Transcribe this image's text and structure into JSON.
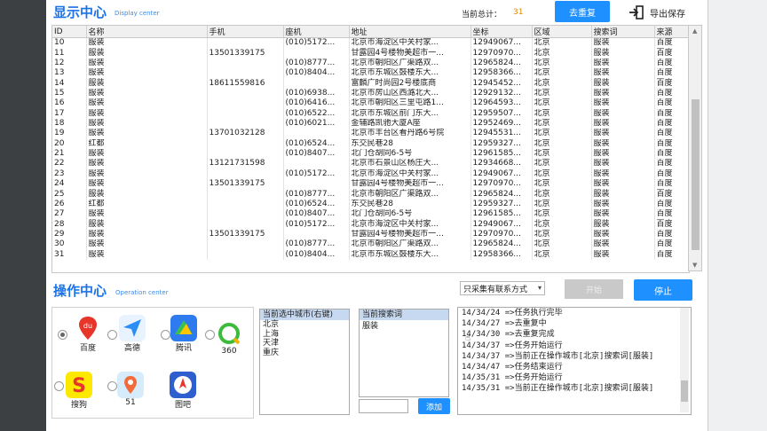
{
  "display": {
    "title": "显示中心",
    "subtitle": "Display center",
    "total_label": "当前总计：",
    "total_value": "31",
    "dedupe_label": "去重复",
    "export_label": "导出保存"
  },
  "table": {
    "columns": [
      "ID",
      "名称",
      "手机",
      "座机",
      "地址",
      "坐标",
      "区域",
      "搜索词",
      "来源"
    ],
    "rows": [
      [
        "10",
        "服装",
        "",
        "(010)5172...",
        "北京市海淀区中关村家...",
        "12949067...",
        "北京",
        "服装",
        "百度"
      ],
      [
        "11",
        "服装",
        "13501339175",
        "",
        "甘露园4号楼物美超市一...",
        "12970970...",
        "北京",
        "服装",
        "百度"
      ],
      [
        "12",
        "服装",
        "",
        "(010)8777...",
        "北京市朝阳区广渠路双...",
        "12965824...",
        "北京",
        "服装",
        "百度"
      ],
      [
        "13",
        "服装",
        "",
        "(010)8404...",
        "北京市东城区鼓楼东大...",
        "12958366...",
        "北京",
        "服装",
        "百度"
      ],
      [
        "14",
        "服装",
        "18611559816",
        "",
        "富麟广时尚园2号楼底商",
        "12945452...",
        "北京",
        "服装",
        "百度"
      ],
      [
        "15",
        "服装",
        "",
        "(010)6938...",
        "北京市房山区西潞北大...",
        "12929132...",
        "北京",
        "服装",
        "百度"
      ],
      [
        "16",
        "服装",
        "",
        "(010)6416...",
        "北京市朝阳区三里屯路1...",
        "12964593...",
        "北京",
        "服装",
        "百度"
      ],
      [
        "17",
        "服装",
        "",
        "(010)6522...",
        "北京市东城区前门东大...",
        "12959507...",
        "北京",
        "服装",
        "百度"
      ],
      [
        "18",
        "服装",
        "",
        "(010)6021...",
        "金辅路凯驰大厦A座",
        "12952469...",
        "北京",
        "服装",
        "百度"
      ],
      [
        "19",
        "服装",
        "13701032128",
        "",
        "北京市丰台区看丹路6号院",
        "12945531...",
        "北京",
        "服装",
        "百度"
      ],
      [
        "20",
        "红都",
        "",
        "(010)6524...",
        "东交民巷28",
        "12959327...",
        "北京",
        "服装",
        "百度"
      ],
      [
        "21",
        "服装",
        "",
        "(010)8407...",
        "北门仓胡同6-5号",
        "12961585...",
        "北京",
        "服装",
        "百度"
      ],
      [
        "22",
        "服装",
        "13121731598",
        "",
        "北京市石景山区杨庄大...",
        "12934668...",
        "北京",
        "服装",
        "百度"
      ],
      [
        "23",
        "服装",
        "",
        "(010)5172...",
        "北京市海淀区中关村家...",
        "12949067...",
        "北京",
        "服装",
        "百度"
      ],
      [
        "24",
        "服装",
        "13501339175",
        "",
        "甘露园4号楼物美超市一...",
        "12970970...",
        "北京",
        "服装",
        "百度"
      ],
      [
        "25",
        "服装",
        "",
        "(010)8777...",
        "北京市朝阳区广渠路双...",
        "12965824...",
        "北京",
        "服装",
        "百度"
      ],
      [
        "26",
        "红都",
        "",
        "(010)6524...",
        "东交民巷28",
        "12959327...",
        "北京",
        "服装",
        "百度"
      ],
      [
        "27",
        "服装",
        "",
        "(010)8407...",
        "北门仓胡同6-5号",
        "12961585...",
        "北京",
        "服装",
        "百度"
      ],
      [
        "28",
        "服装",
        "",
        "(010)5172...",
        "北京市海淀区中关村家...",
        "12949067...",
        "北京",
        "服装",
        "百度"
      ],
      [
        "29",
        "服装",
        "13501339175",
        "",
        "甘露园4号楼物美超市一...",
        "12970970...",
        "北京",
        "服装",
        "百度"
      ],
      [
        "30",
        "服装",
        "",
        "(010)8777...",
        "北京市朝阳区广渠路双...",
        "12965824...",
        "北京",
        "服装",
        "百度"
      ],
      [
        "31",
        "服装",
        "",
        "(010)8404...",
        "北京市东城区鼓楼东大...",
        "12958366...",
        "北京",
        "服装",
        "百度"
      ]
    ]
  },
  "operation": {
    "title": "操作中心",
    "subtitle": "Operation center",
    "filter_value": "只采集有联系方式",
    "start_label": "开始",
    "stop_label": "停止"
  },
  "maps": [
    {
      "name": "百度",
      "icon": "baidu-map-icon",
      "color": "#e8352a"
    },
    {
      "name": "高德",
      "icon": "amap-icon",
      "color": "#2c8df4"
    },
    {
      "name": "腾讯",
      "icon": "tencent-map-icon",
      "color": "#2e7bf0"
    },
    {
      "name": "360",
      "icon": "360-map-icon",
      "color": "#3cbb3c"
    },
    {
      "name": "搜狗",
      "icon": "sogou-map-icon",
      "color": "#e8352a"
    },
    {
      "name": "51",
      "icon": "51-map-icon",
      "color": "#35a0f0"
    },
    {
      "name": "图吧",
      "icon": "mapbar-icon",
      "color": "#2f5fcf"
    }
  ],
  "cities": {
    "header": "当前选中城市(右键)",
    "items": [
      "北京",
      "上海",
      "天津",
      "重庆"
    ]
  },
  "keywords": {
    "header": "当前搜索词",
    "items": [
      "服装"
    ],
    "add_label": "添加"
  },
  "log": [
    "14/34/24 =>任务执行完毕",
    "14/34/27 =>去重复中",
    "14/34/30 =>去重复完成",
    "14/34/37 =>任务开始运行",
    "14/34/37 =>当前正在操作城市[北京]搜索词[服装]",
    "14/34/47 =>任务结束运行",
    "14/35/31 =>任务开始运行",
    "14/35/31 =>当前正在操作城市[北京]搜索词[服装]"
  ]
}
